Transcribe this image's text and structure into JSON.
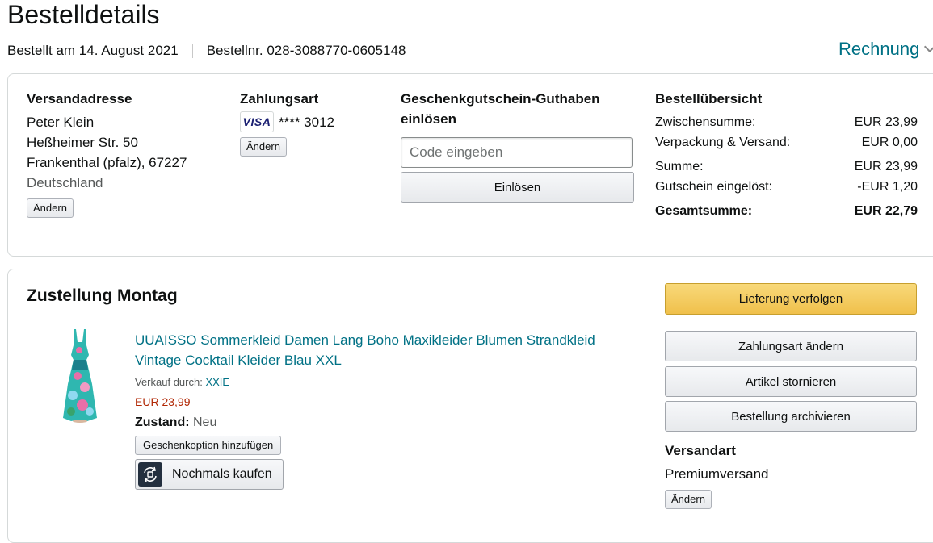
{
  "header": {
    "title": "Bestelldetails",
    "ordered_on": "Bestellt am 14. August 2021",
    "order_number": "Bestellnr. 028-3088770-0605148",
    "invoice_label": "Rechnung"
  },
  "shipping_address": {
    "heading": "Versandadresse",
    "name": "Peter Klein",
    "street": "Heßheimer Str. 50",
    "city": "Frankenthal (pfalz), 67227",
    "country": "Deutschland",
    "change_label": "Ändern"
  },
  "payment": {
    "heading": "Zahlungsart",
    "card_brand": "VISA",
    "card_masked": "**** 3012",
    "change_label": "Ändern"
  },
  "gift_card": {
    "heading_line1": "Geschenkgutschein-Guthaben",
    "heading_line2": "einlösen",
    "input_placeholder": "Code eingeben",
    "input_value": "",
    "redeem_label": "Einlösen"
  },
  "summary": {
    "heading": "Bestellübersicht",
    "rows": [
      {
        "label": "Zwischensumme:",
        "value": "EUR 23,99"
      },
      {
        "label": "Verpackung & Versand:",
        "value": "EUR 0,00"
      },
      {
        "label": "Summe:",
        "value": "EUR 23,99"
      },
      {
        "label": "Gutschein eingelöst:",
        "value": "-EUR 1,20"
      }
    ],
    "total_label": "Gesamtsumme:",
    "total_value": "EUR 22,79"
  },
  "shipment": {
    "heading": "Zustellung Montag",
    "product": {
      "title_line1": "UUAISSO Sommerkleid Damen Lang Boho Maxikleider Blumen Strandkleid",
      "title_line2": "Vintage Cocktail Kleider Blau XXL",
      "sold_by_label": "Verkauf durch:",
      "seller": "XXIE",
      "price": "EUR 23,99",
      "condition_label": "Zustand:",
      "condition_value": "Neu",
      "gift_option_label": "Geschenkoption hinzufügen",
      "buy_again_label": "Nochmals kaufen"
    },
    "actions": {
      "track": "Lieferung verfolgen",
      "change_payment": "Zahlungsart ändern",
      "cancel": "Artikel stornieren",
      "archive": "Bestellung archivieren"
    },
    "shipping_method": {
      "heading": "Versandart",
      "value": "Premiumversand",
      "change_label": "Ändern"
    }
  },
  "colors": {
    "link": "#007185",
    "price": "#b12704",
    "primary_button": "#f0c04b"
  }
}
